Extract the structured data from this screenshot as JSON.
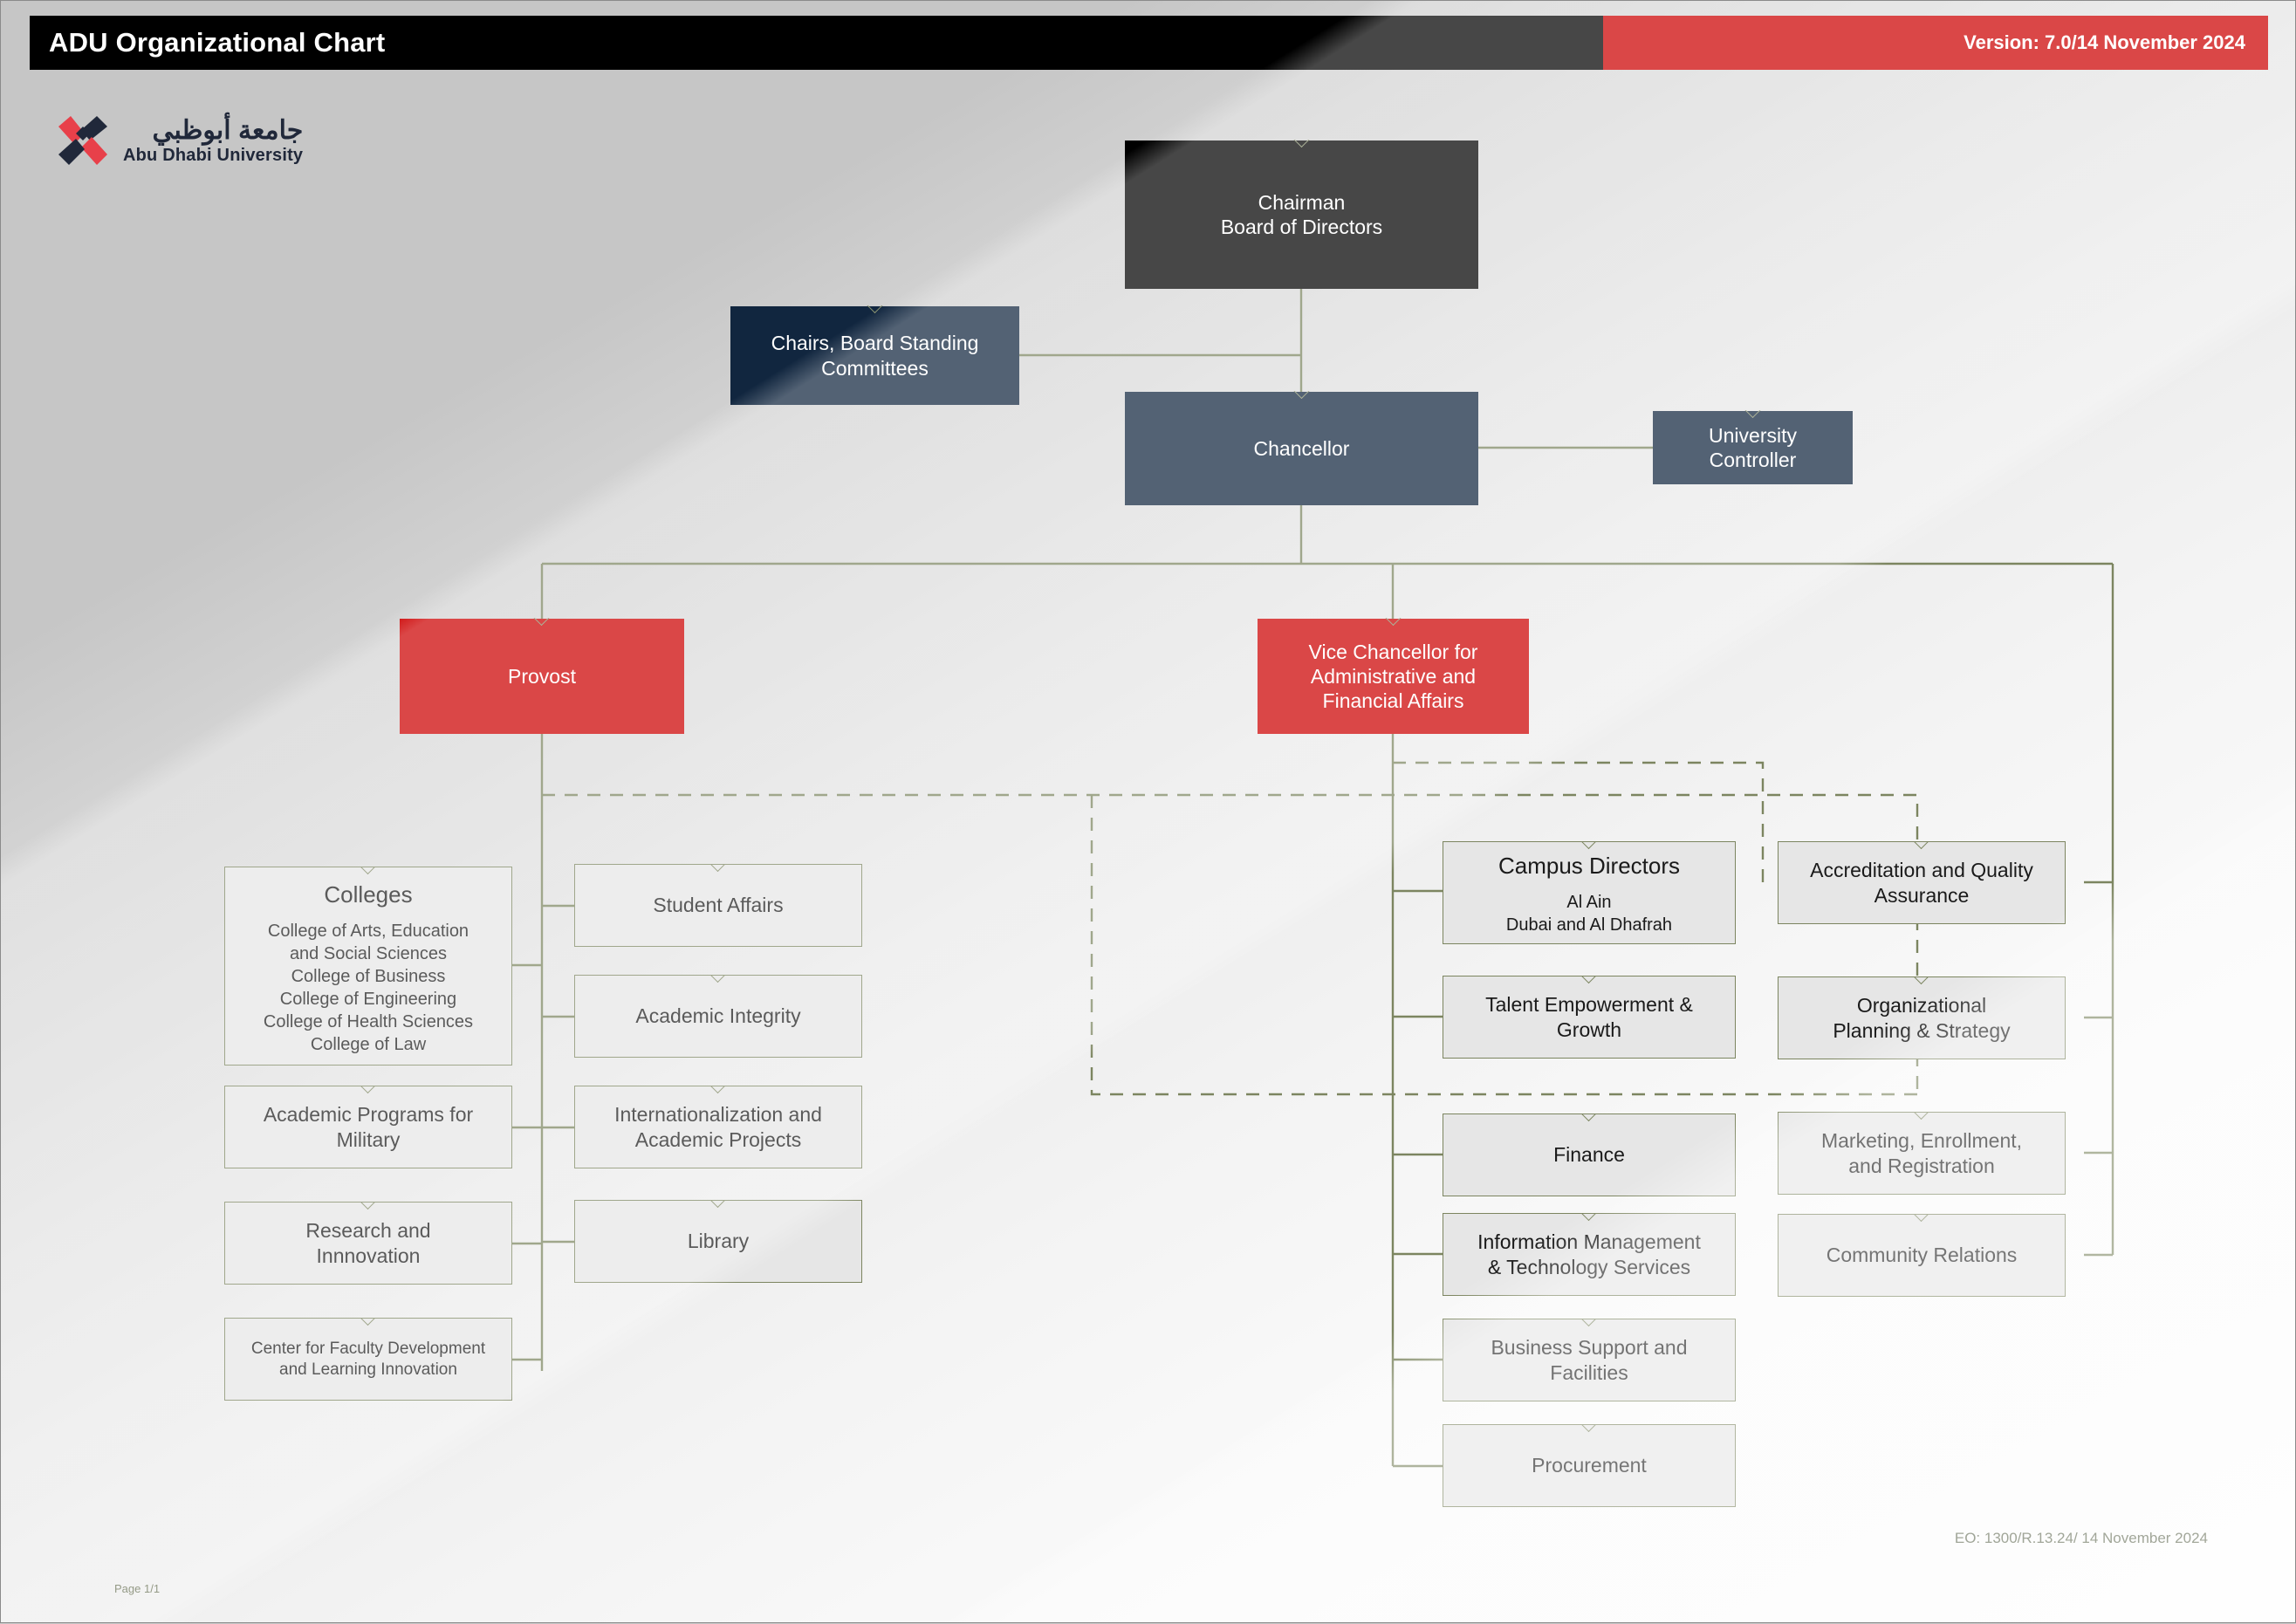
{
  "header": {
    "title": "ADU Organizational Chart",
    "version": "Version: 7.0/14 November 2024"
  },
  "logo": {
    "arabic": "جامعة أبوظبي",
    "english": "Abu Dhabi University",
    "mark": "adu-pinwheel-logo"
  },
  "colors": {
    "black": "#000000",
    "navy": "#11263f",
    "red": "#cc0000",
    "box_fill": "#e6e6e6",
    "box_border": "#7c8560",
    "connector": "#7c8560"
  },
  "nodes": {
    "chairman": {
      "line1": "Chairman",
      "line2": "Board of Directors"
    },
    "chairs_committees": {
      "line1": "Chairs, Board Standing",
      "line2": "Committees"
    },
    "chancellor": {
      "line1": "Chancellor"
    },
    "university_controller": {
      "line1": "University",
      "line2": "Controller"
    },
    "provost": {
      "line1": "Provost"
    },
    "vice_chancellor": {
      "line1": "Vice Chancellor for",
      "line2": "Administrative and",
      "line3": "Financial Affairs"
    },
    "colleges": {
      "title": "Colleges",
      "items": [
        "College of Arts, Education",
        "and Social Sciences",
        "College of Business",
        "College of Engineering",
        "College of Health Sciences",
        "College of Law"
      ]
    },
    "academic_programs_military": {
      "line1": "Academic Programs for",
      "line2": "Military"
    },
    "research_innovation": {
      "line1": "Research and",
      "line2": "Innnovation"
    },
    "center_faculty_development": {
      "line1": "Center for Faculty Development",
      "line2": "and Learning Innovation"
    },
    "student_affairs": {
      "line1": "Student Affairs"
    },
    "academic_integrity": {
      "line1": "Academic Integrity"
    },
    "internationalization": {
      "line1": "Internationalization and",
      "line2": "Academic Projects"
    },
    "library": {
      "line1": "Library"
    },
    "campus_directors": {
      "title": "Campus Directors",
      "items": [
        "Al Ain",
        "Dubai and Al Dhafrah"
      ]
    },
    "talent_empowerment": {
      "line1": "Talent Empowerment &",
      "line2": "Growth"
    },
    "finance": {
      "line1": "Finance"
    },
    "information_management": {
      "line1": "Information Management",
      "line2": "& Technology Services"
    },
    "business_support": {
      "line1": "Business Support and",
      "line2": "Facilities"
    },
    "procurement": {
      "line1": "Procurement"
    },
    "accreditation_quality": {
      "line1": "Accreditation and Quality",
      "line2": "Assurance"
    },
    "organizational_planning": {
      "line1": "Organizational",
      "line2": "Planning & Strategy"
    },
    "marketing_enrollment": {
      "line1": "Marketing, Enrollment,",
      "line2": "and Registration"
    },
    "community_relations": {
      "line1": "Community Relations"
    }
  },
  "footer": {
    "eo": "EO: 1300/R.13.24/ 14 November 2024",
    "page": "Page 1/1"
  }
}
